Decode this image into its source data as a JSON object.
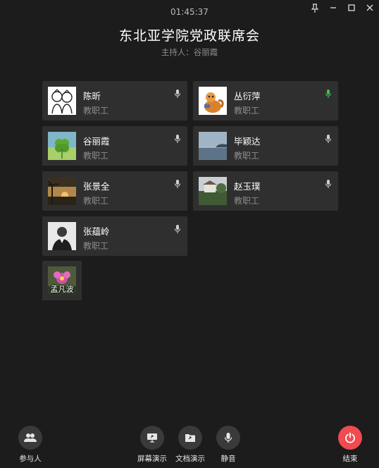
{
  "window": {
    "timer": "01:45:37",
    "controls": [
      {
        "name": "pin-icon"
      },
      {
        "name": "minimize-icon"
      },
      {
        "name": "maximize-icon"
      },
      {
        "name": "close-icon"
      }
    ]
  },
  "meeting": {
    "title": "东北亚学院党政联席会",
    "host": "主持人：谷丽霞"
  },
  "participants": [
    {
      "name": "陈昕",
      "role": "教职工",
      "mic": "muted-gray",
      "avatar": "cartoon-avatar"
    },
    {
      "name": "丛衍萍",
      "role": "教职工",
      "mic": "active-green",
      "avatar": "squirrel-avatar"
    },
    {
      "name": "谷丽霞",
      "role": "教职工",
      "mic": "muted-gray",
      "avatar": "clover-avatar"
    },
    {
      "name": "毕颖达",
      "role": "教职工",
      "mic": "muted-gray",
      "avatar": "sea-avatar"
    },
    {
      "name": "张景全",
      "role": "教职工",
      "mic": "muted-gray",
      "avatar": "sunset-avatar"
    },
    {
      "name": "赵玉璞",
      "role": "教职工",
      "mic": "muted-gray",
      "avatar": "garden-avatar"
    },
    {
      "name": "张蕴岭",
      "role": "教职工",
      "mic": "muted-gray",
      "avatar": "portrait-avatar"
    }
  ],
  "waiting": {
    "name": "孟凡波",
    "avatar": "flower-avatar"
  },
  "colors": {
    "background": "#1c1c1c",
    "card": "#2f2f2f",
    "mic_active": "#3ec34f",
    "end_button": "#ef4b50"
  },
  "toolbar": {
    "participants_label": "参与人",
    "screen_share_label": "屏幕演示",
    "doc_share_label": "文档演示",
    "mute_label": "静音",
    "end_label": "结束"
  }
}
